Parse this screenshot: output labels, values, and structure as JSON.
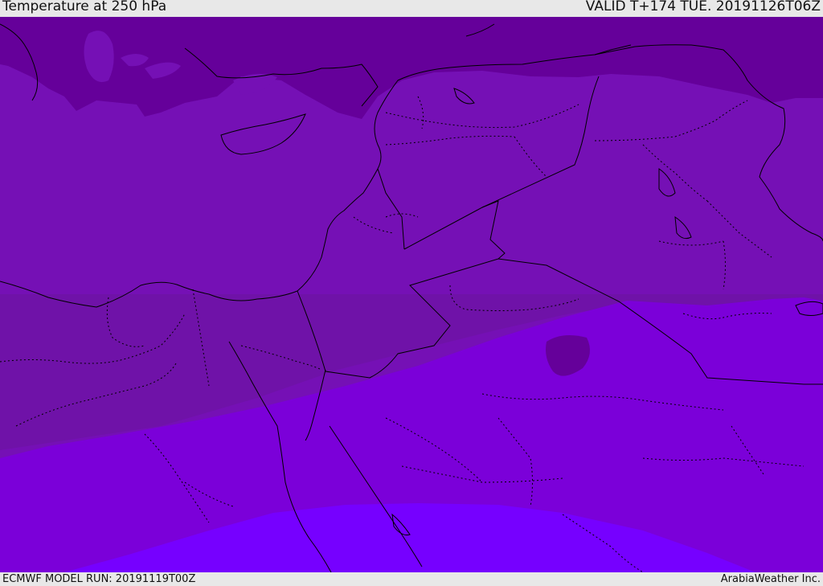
{
  "header": {
    "title": "Temperature at 250 hPa",
    "valid": "VALID T+174 TUE. 20191126T06Z"
  },
  "footer": {
    "model_run": "ECMWF MODEL RUN: 20191119T00Z",
    "credit": "ArabiaWeather Inc."
  },
  "colors": {
    "band_coldest": "#65009a",
    "band_cold": "#7510b5",
    "band_cool": "#6f12a8",
    "band_mid": "#7b00d9",
    "band_warm": "#7600ff",
    "borders": "#000000"
  }
}
